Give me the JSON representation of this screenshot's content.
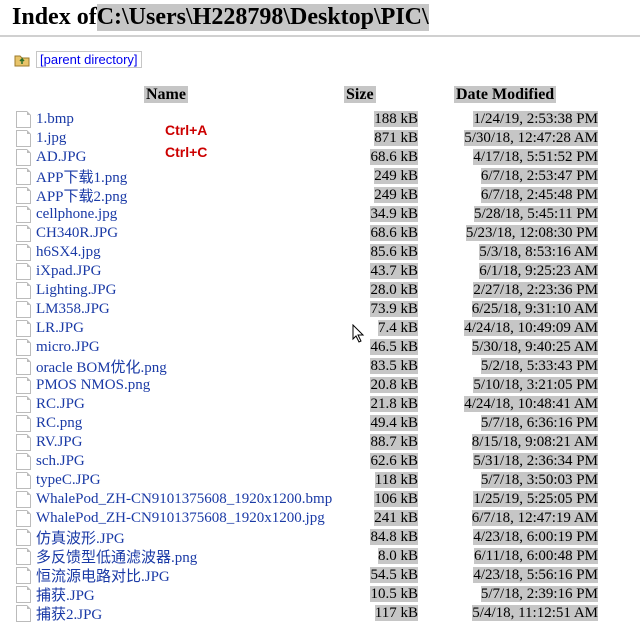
{
  "title_prefix": "Index of ",
  "title_path": "C:\\Users\\H228798\\Desktop\\PIC\\",
  "parent_label": "[parent directory]",
  "columns": {
    "name": "Name",
    "size": "Size",
    "date": "Date Modified"
  },
  "annotations": {
    "a1": "Ctrl+A",
    "a2": "Ctrl+C"
  },
  "files": [
    {
      "name": "1.bmp",
      "size": "188 kB",
      "date": "1/24/19, 2:53:38 PM"
    },
    {
      "name": "1.jpg",
      "size": "871 kB",
      "date": "5/30/18, 12:47:28 AM"
    },
    {
      "name": "AD.JPG",
      "size": "68.6 kB",
      "date": "4/17/18, 5:51:52 PM"
    },
    {
      "name": "APP下载1.png",
      "size": "249 kB",
      "date": "6/7/18, 2:53:47 PM"
    },
    {
      "name": "APP下载2.png",
      "size": "249 kB",
      "date": "6/7/18, 2:45:48 PM"
    },
    {
      "name": "cellphone.jpg",
      "size": "34.9 kB",
      "date": "5/28/18, 5:45:11 PM"
    },
    {
      "name": "CH340R.JPG",
      "size": "68.6 kB",
      "date": "5/23/18, 12:08:30 PM"
    },
    {
      "name": "h6SX4.jpg",
      "size": "85.6 kB",
      "date": "5/3/18, 8:53:16 AM"
    },
    {
      "name": "iXpad.JPG",
      "size": "43.7 kB",
      "date": "6/1/18, 9:25:23 AM"
    },
    {
      "name": "Lighting.JPG",
      "size": "28.0 kB",
      "date": "2/27/18, 2:23:36 PM"
    },
    {
      "name": "LM358.JPG",
      "size": "73.9 kB",
      "date": "6/25/18, 9:31:10 AM"
    },
    {
      "name": "LR.JPG",
      "size": "7.4 kB",
      "date": "4/24/18, 10:49:09 AM"
    },
    {
      "name": "micro.JPG",
      "size": "46.5 kB",
      "date": "5/30/18, 9:40:25 AM"
    },
    {
      "name": "oracle BOM优化.png",
      "size": "83.5 kB",
      "date": "5/2/18, 5:33:43 PM"
    },
    {
      "name": "PMOS NMOS.png",
      "size": "20.8 kB",
      "date": "5/10/18, 3:21:05 PM"
    },
    {
      "name": "RC.JPG",
      "size": "21.8 kB",
      "date": "4/24/18, 10:48:41 AM"
    },
    {
      "name": "RC.png",
      "size": "49.4 kB",
      "date": "5/7/18, 6:36:16 PM"
    },
    {
      "name": "RV.JPG",
      "size": "88.7 kB",
      "date": "8/15/18, 9:08:21 AM"
    },
    {
      "name": "sch.JPG",
      "size": "62.6 kB",
      "date": "5/31/18, 2:36:34 PM"
    },
    {
      "name": "typeC.JPG",
      "size": "118 kB",
      "date": "5/7/18, 3:50:03 PM"
    },
    {
      "name": "WhalePod_ZH-CN9101375608_1920x1200.bmp",
      "size": "106 kB",
      "date": "1/25/19, 5:25:05 PM"
    },
    {
      "name": "WhalePod_ZH-CN9101375608_1920x1200.jpg",
      "size": "241 kB",
      "date": "6/7/18, 12:47:19 AM"
    },
    {
      "name": "仿真波形.JPG",
      "size": "84.8 kB",
      "date": "4/23/18, 6:00:19 PM"
    },
    {
      "name": "多反馈型低通滤波器.png",
      "size": "8.0 kB",
      "date": "6/11/18, 6:00:48 PM"
    },
    {
      "name": "恒流源电路对比.JPG",
      "size": "54.5 kB",
      "date": "4/23/18, 5:56:16 PM"
    },
    {
      "name": "捕获.JPG",
      "size": "10.5 kB",
      "date": "5/7/18, 2:39:16 PM"
    },
    {
      "name": "捕获2.JPG",
      "size": "117 kB",
      "date": "5/4/18, 11:12:51 AM"
    }
  ]
}
